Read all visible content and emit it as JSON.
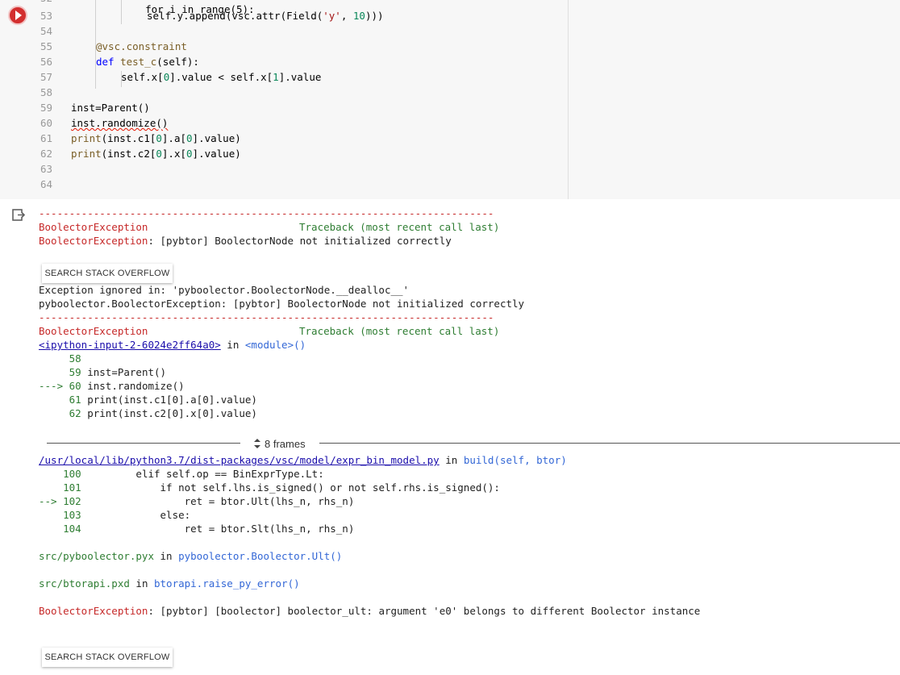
{
  "editor": {
    "lines": [
      {
        "num": "53",
        "text": "self.y.append(vsc.attr(Field('y', 10)))"
      },
      {
        "num": "54",
        "text": ""
      },
      {
        "num": "55",
        "text": "@vsc.constraint"
      },
      {
        "num": "56",
        "text": "def test_c(self):"
      },
      {
        "num": "57",
        "text": "self.x[0].value < self.x[1].value"
      },
      {
        "num": "58",
        "text": ""
      },
      {
        "num": "59",
        "text": "inst=Parent()"
      },
      {
        "num": "60",
        "text": "inst.randomize()"
      },
      {
        "num": "61",
        "text": "print(inst.c1[0].a[0].value)"
      },
      {
        "num": "62",
        "text": "print(inst.c2[0].x[0].value)"
      },
      {
        "num": "63",
        "text": ""
      },
      {
        "num": "64",
        "text": ""
      }
    ],
    "top_partial": "for i in range(5):"
  },
  "output": {
    "dashes": "---------------------------------------------------------------------------",
    "tb1_name": "BoolectorException",
    "tb1_header": "Traceback (most recent call last)",
    "tb1_msg_type": "BoolectorException",
    "tb1_msg": ": [pybtor] BoolectorNode not initialized correctly",
    "search_button_1": "SEARCH STACK OVERFLOW",
    "ignored_1": "Exception ignored in: 'pyboolector.BoolectorNode.__dealloc__'",
    "ignored_2": "pyboolector.BoolectorException: [pybtor] BoolectorNode not initialized correctly",
    "tb2_name": "BoolectorException",
    "tb2_header": "Traceback (most recent call last)",
    "ipython_link": "<ipython-input-2-6024e2ff64a0>",
    "in_word": " in ",
    "module_text": "<module>()",
    "frame1_lines": [
      "     58 ",
      "     59 inst=Parent()",
      "---> 60 inst.randomize()",
      "     61 print(inst.c1[0].a[0].value)",
      "     62 print(inst.c2[0].x[0].value)"
    ],
    "frames_label": "8 frames",
    "file_link": "/usr/local/lib/python3.7/dist-packages/vsc/model/expr_bin_model.py",
    "build_text": "build(self, btor)",
    "frame2_lines": [
      "    100         elif self.op == BinExprType.Lt:",
      "    101             if not self.lhs.is_signed() or not self.rhs.is_signed():",
      "--> 102                 ret = btor.Ult(lhs_n, rhs_n)",
      "    103             else:",
      "    104                 ret = btor.Slt(lhs_n, rhs_n)"
    ],
    "pyx_file": "src/pyboolector.pyx",
    "pyx_func": "pyboolector.Boolector.Ult()",
    "pxd_file": "src/btorapi.pxd",
    "pxd_func": "btorapi.raise_py_error()",
    "final_type": "BoolectorException",
    "final_msg": ": [pybtor] [boolector] boolector_ult: argument 'e0' belongs to different Boolector instance",
    "search_button_2": "SEARCH STACK OVERFLOW"
  },
  "colors": {
    "error_red": "#c62828",
    "link_blue": "#1a0dab",
    "func_blue": "#3367d6",
    "run_red": "#d32f2f"
  }
}
